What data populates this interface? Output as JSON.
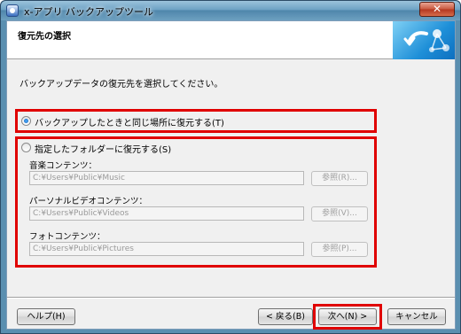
{
  "window": {
    "title": "x-アプリ バックアップツール",
    "close_label": "✕"
  },
  "header": {
    "title": "復元先の選択"
  },
  "instruction": "バックアップデータの復元先を選択してください。",
  "options": {
    "same_location": {
      "label": "バックアップしたときと同じ場所に復元する(T)",
      "checked": true
    },
    "specified_folder": {
      "label": "指定したフォルダーに復元する(S)",
      "checked": false
    }
  },
  "folders": [
    {
      "label": "音楽コンテンツ：",
      "path": "C:¥Users¥Public¥Music",
      "browse_label": "参照(R)..."
    },
    {
      "label": "パーソナルビデオコンテンツ：",
      "path": "C:¥Users¥Public¥Videos",
      "browse_label": "参照(V)..."
    },
    {
      "label": "フォトコンテンツ：",
      "path": "C:¥Users¥Public¥Pictures",
      "browse_label": "参照(P)..."
    }
  ],
  "footer": {
    "help_label": "ヘルプ(H)",
    "back_label": "< 戻る(B)",
    "next_label": "次へ(N) >",
    "cancel_label": "キャンセル"
  },
  "colors": {
    "highlight": "#e00000",
    "titlebar": "#5a8fb0"
  },
  "icons": {
    "app": "app-icon",
    "logo": "x-app-logo-icon"
  }
}
